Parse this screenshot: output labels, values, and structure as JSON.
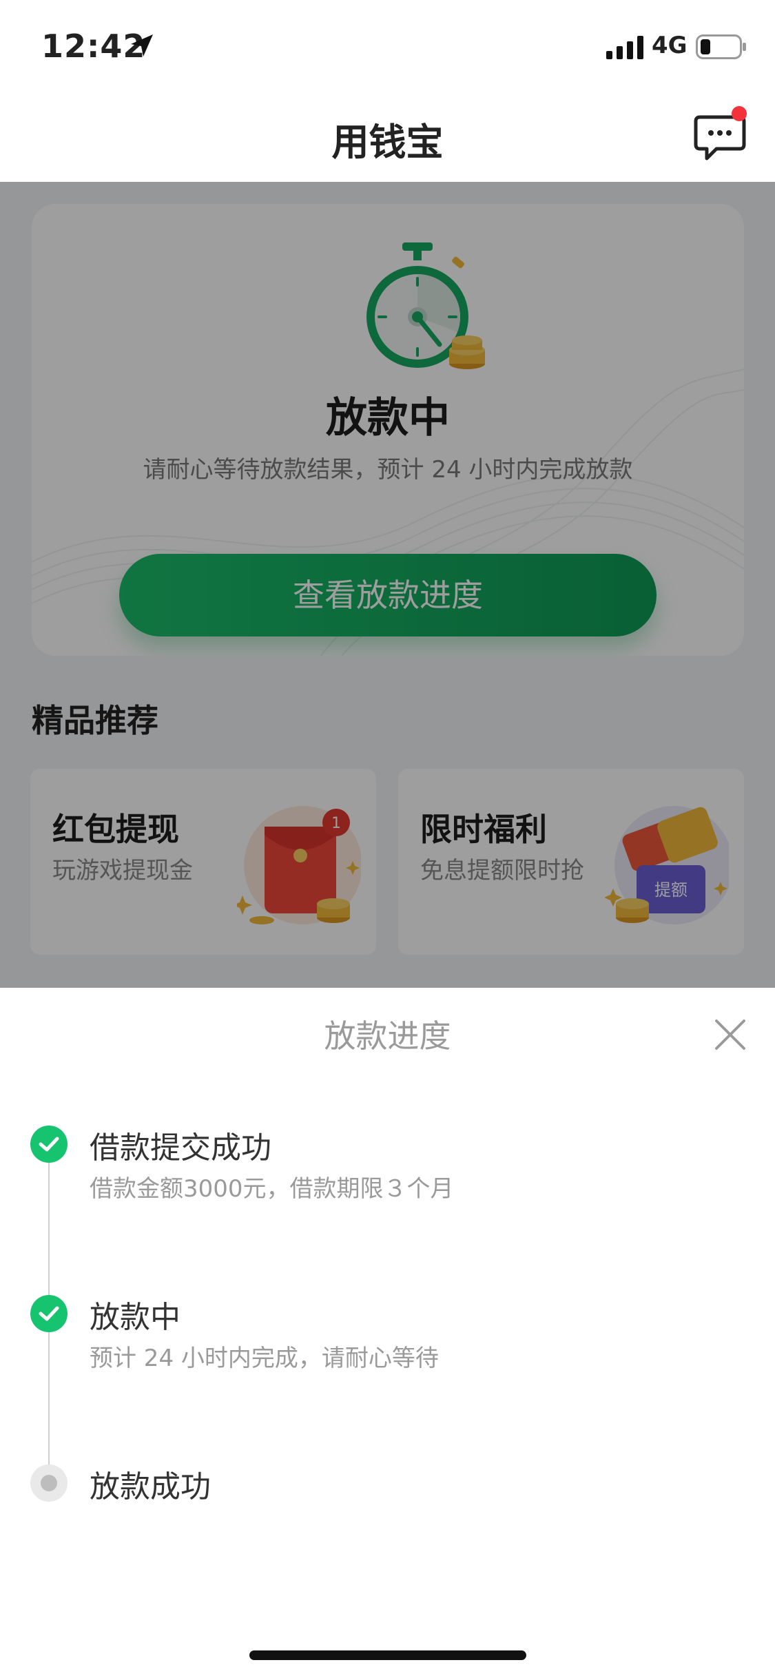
{
  "status_bar": {
    "time": "12:42",
    "network": "4G",
    "icons": [
      "location-arrow-icon",
      "signal-icon",
      "battery-icon"
    ]
  },
  "nav": {
    "title": "用钱宝",
    "message_icon": "chat-bubble-icon",
    "has_unread_dot": true,
    "unread_dot_color": "#f3323c"
  },
  "hero": {
    "icon": "stopwatch-coins-icon",
    "title": "放款中",
    "subtitle": "请耐心等待放款结果，预计 24 小时内完成放款",
    "button_label": "查看放款进度"
  },
  "recommend": {
    "section_title": "精品推荐",
    "cards": [
      {
        "title": "红包提现",
        "subtitle": "玩游戏提现金",
        "art_icon": "red-envelope-icon",
        "badge": "1"
      },
      {
        "title": "限时福利",
        "subtitle": "免息提额限时抢",
        "art_icon": "coupon-ticket-icon",
        "art_label": "提额"
      }
    ]
  },
  "sheet": {
    "title": "放款进度",
    "close_icon": "close-icon",
    "steps": [
      {
        "title": "借款提交成功",
        "desc": "借款金额3000元，借款期限３个月",
        "status": "done"
      },
      {
        "title": "放款中",
        "desc": "预计 24 小时内完成，请耐心等待",
        "status": "done"
      },
      {
        "title": "放款成功",
        "desc": "",
        "status": "pending"
      }
    ]
  },
  "colors": {
    "accent_green": "#16c36f",
    "button_green_start": "#1bbd6b",
    "button_green_end": "#0f9a55",
    "overlay": "rgba(0,0,0,0.38)"
  }
}
